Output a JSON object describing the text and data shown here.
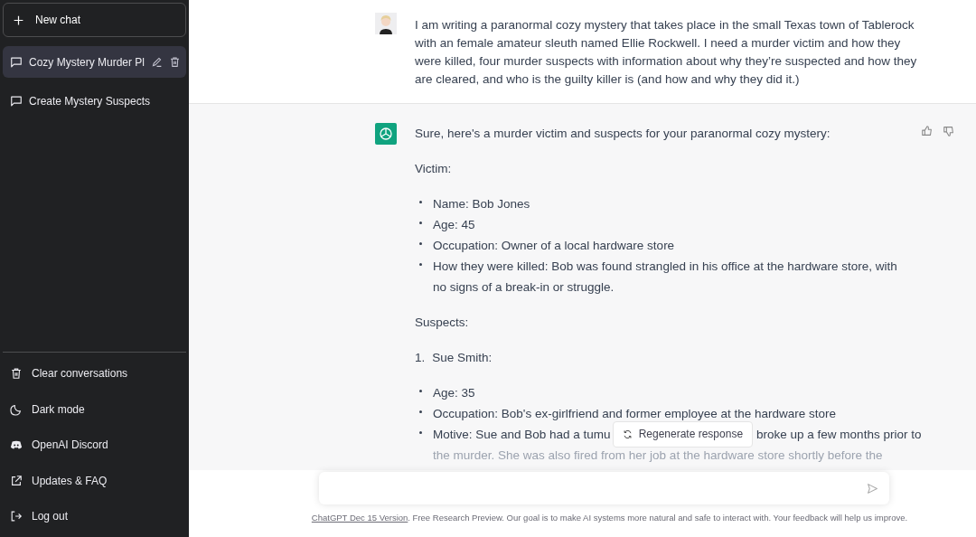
{
  "sidebar": {
    "new_chat": "New chat",
    "conversations": [
      {
        "title": "Cozy Mystery Murder Pl",
        "selected": true
      },
      {
        "title": "Create Mystery Suspects",
        "selected": false
      }
    ],
    "menu": [
      {
        "kind": "trash",
        "label": "Clear conversations"
      },
      {
        "kind": "moon",
        "label": "Dark mode"
      },
      {
        "kind": "discord",
        "label": "OpenAI Discord"
      },
      {
        "kind": "external",
        "label": "Updates & FAQ"
      },
      {
        "kind": "logout",
        "label": "Log out"
      }
    ]
  },
  "user_message": "I am writing a paranormal cozy mystery that takes place in the small Texas town of Tablerock with an female amateur sleuth named Ellie Rockwell. I need a murder victim and how they were killed, four murder suspects with information about why they’re suspected and how they are cleared, and who is the guilty killer is (and how and why they did it.)",
  "assistant_blocks": [
    {
      "kind": "paragraph",
      "text": "Sure, here's a murder victim and suspects for your paranormal cozy mystery:"
    },
    {
      "kind": "paragraph",
      "text": "Victim:"
    },
    {
      "kind": "bullets",
      "items": [
        {
          "kind": "text",
          "text": "Name: Bob Jones"
        },
        {
          "kind": "text",
          "text": "Age: 45"
        },
        {
          "kind": "text",
          "text": "Occupation: Owner of a local hardware store"
        },
        {
          "kind": "text",
          "text": "How they were killed: Bob was found strangled in his office at the hardware store, with no signs of a break-in or struggle."
        }
      ]
    },
    {
      "kind": "paragraph",
      "text": "Suspects:"
    },
    {
      "kind": "numbered",
      "number": "1.",
      "text": "Sue Smith:"
    },
    {
      "kind": "bullets",
      "items": [
        {
          "kind": "text",
          "text": "Age: 35"
        },
        {
          "kind": "text",
          "text": "Occupation: Bob's ex-girlfriend and former employee at the hardware store"
        },
        {
          "kind": "split",
          "text_before": "Motive: Sue and Bob had a tumu",
          "text_after": "broke up a few months prior to",
          "text_faded": "the murder. She was also fired from her job at the hardware store shortly before the"
        }
      ]
    }
  ],
  "regenerate": "Regenerate response",
  "footer": {
    "link": "ChatGPT Dec 15 Version",
    "text": ". Free Research Preview. Our goal is to make AI systems more natural and safe to interact with. Your feedback will help us improve."
  }
}
